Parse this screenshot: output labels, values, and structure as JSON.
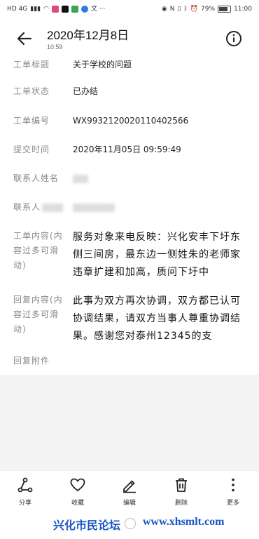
{
  "status_bar": {
    "left_text": "HD 4G",
    "right_text_battery": "79%",
    "time": "11:00",
    "battery_level": 0.79
  },
  "header": {
    "title": "2020年12月8日",
    "subtitle": "10:59"
  },
  "fields": [
    {
      "label": "工单标题",
      "value": "关于学校的问题"
    },
    {
      "label": "工单状态",
      "value": "已办结"
    },
    {
      "label": "工单编号",
      "value": "WX993212002011040256​6"
    },
    {
      "label": "提交时间",
      "value": "2020年11月05日    09:59:49"
    },
    {
      "label": "联系人姓名",
      "value": ""
    },
    {
      "label": "联系人",
      "value": ""
    }
  ],
  "content_field": {
    "label": "工单内容(内容过多可滑动)",
    "value": "服务对象来电反映：兴化安丰下圩东侧三间房，最东边一侧姓朱的老师家违章扩建和加高，质问下圩中"
  },
  "reply_field": {
    "label": "回复内容(内容过多可滑动)",
    "value": "此事为双方再次协调，双方都已认可协调结果，请双方当事人尊重协调结果。感谢您对泰州12345的支"
  },
  "attachment_label": "回复附件",
  "toolbar": {
    "share": "分享",
    "favorite": "收藏",
    "edit": "编辑",
    "delete": "删除",
    "more": "更多"
  },
  "watermark": {
    "name": "兴化市民论坛",
    "url": "www.xhsmlt.com"
  }
}
